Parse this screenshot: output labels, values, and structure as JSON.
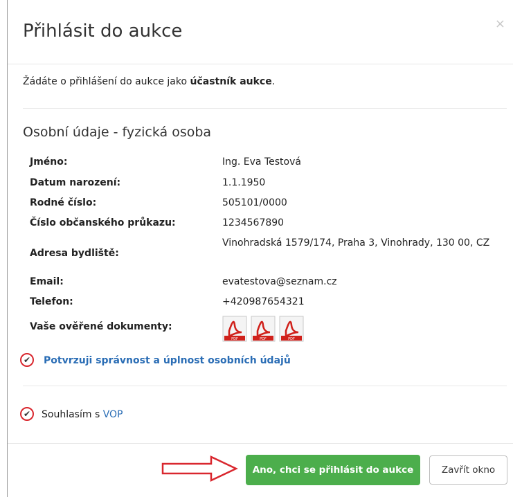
{
  "modal": {
    "title": "Přihlásit do aukce",
    "close_glyph": "×"
  },
  "intro": {
    "text_before": "Žádáte o přihlášení do aukce jako ",
    "role": "účastník aukce",
    "text_after": "."
  },
  "section": {
    "title": "Osobní údaje - fyzická osoba"
  },
  "personal": {
    "name_label": "Jméno:",
    "name_value": "Ing. Eva Testová",
    "birth_label": "Datum narození:",
    "birth_value": "1.1.1950",
    "id_label": "Rodné číslo:",
    "id_value": "505101/0000",
    "card_label": "Číslo občanského průkazu:",
    "card_value": "1234567890",
    "address_label": "Adresa bydliště:",
    "address_value": "Vinohradská 1579/174, Praha 3, Vinohrady, 130 00, CZ",
    "email_label": "Email:",
    "email_value": "evatestova@seznam.cz",
    "phone_label": "Telefon:",
    "phone_value": "+420987654321",
    "docs_label": "Vaše ověřené dokumenty:",
    "doc_icon_text": "PDF"
  },
  "confirm": {
    "label": "Potvrzuji správnost a úplnost osobních údajů",
    "checked": true
  },
  "consent": {
    "text": "Souhlasím s ",
    "link": "VOP",
    "checked": true
  },
  "footer": {
    "primary_label": "Ano, chci se přihlásit do aukce",
    "close_label": "Zavřít okno"
  },
  "colors": {
    "primary": "#4cae4c",
    "link": "#2a6db5",
    "highlight": "#d9272e"
  }
}
